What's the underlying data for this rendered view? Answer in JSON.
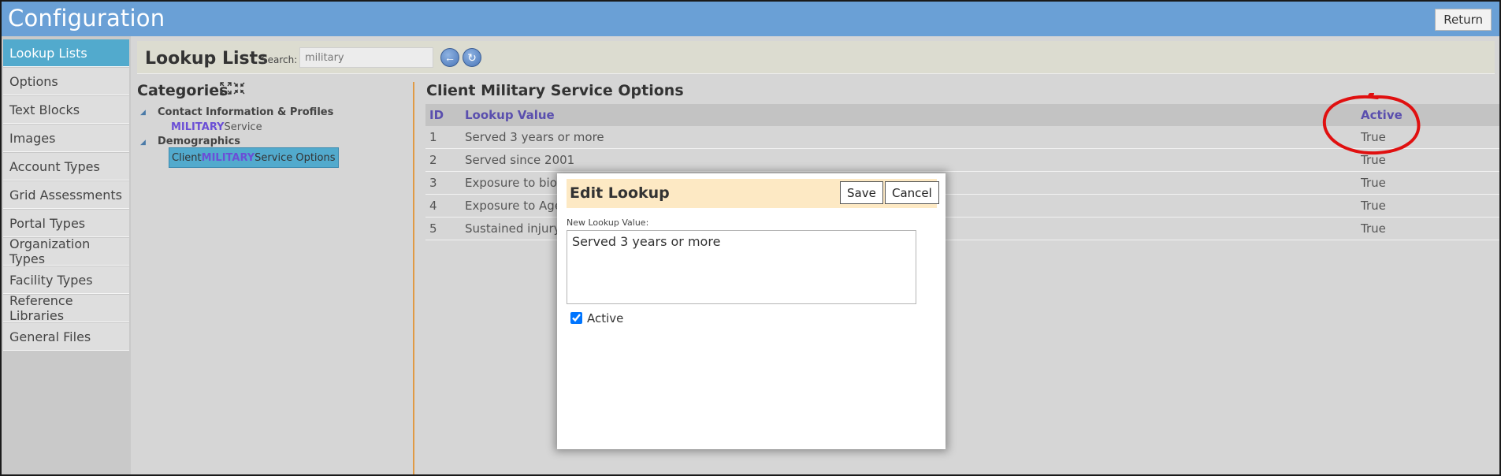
{
  "app": {
    "title": "Configuration",
    "return_label": "Return"
  },
  "sidebar": {
    "items": [
      {
        "label": "Lookup Lists",
        "active": true
      },
      {
        "label": "Options"
      },
      {
        "label": "Text Blocks"
      },
      {
        "label": "Images"
      },
      {
        "label": "Account Types"
      },
      {
        "label": "Grid Assessments"
      },
      {
        "label": "Portal Types"
      },
      {
        "label": "Organization Types"
      },
      {
        "label": "Facility Types"
      },
      {
        "label": "Reference Libraries"
      },
      {
        "label": "General Files"
      }
    ]
  },
  "lookup": {
    "title": "Lookup Lists",
    "search_label": "Search:",
    "search_value": "military"
  },
  "categories": {
    "title": "Categories",
    "expand_icon": "expand-collapse-icon",
    "groups": [
      {
        "label": "Contact Information & Profiles",
        "items": [
          {
            "highlight": "MILITARY",
            "suffix": " Service",
            "prefix": ""
          }
        ]
      },
      {
        "label": "Demographics",
        "items": [
          {
            "prefix": "Client ",
            "highlight": "MILITARY",
            "suffix": " Service Options",
            "selected": true
          }
        ]
      }
    ]
  },
  "options": {
    "title": "Client Military Service Options",
    "columns": {
      "id": "ID",
      "value": "Lookup Value",
      "active": "Active"
    },
    "rows": [
      {
        "id": "1",
        "value": "Served 3 years or more",
        "active": "True"
      },
      {
        "id": "2",
        "value": "Served since 2001",
        "active": "True"
      },
      {
        "id": "3",
        "value": "Exposure to biolo",
        "active": "True"
      },
      {
        "id": "4",
        "value": "Exposure to Agen",
        "active": "True"
      },
      {
        "id": "5",
        "value": "Sustained injury",
        "active": "True"
      }
    ]
  },
  "modal": {
    "title": "Edit Lookup",
    "save_label": "Save",
    "cancel_label": "Cancel",
    "field_label": "New Lookup Value:",
    "field_value": "Served 3 years or more",
    "active_label": "Active",
    "active_checked": true
  },
  "colors": {
    "titlebar": "#6aa0d6",
    "accent": "#52aacd",
    "highlight_text": "#6b4fd6",
    "annotation": "#e01010"
  }
}
